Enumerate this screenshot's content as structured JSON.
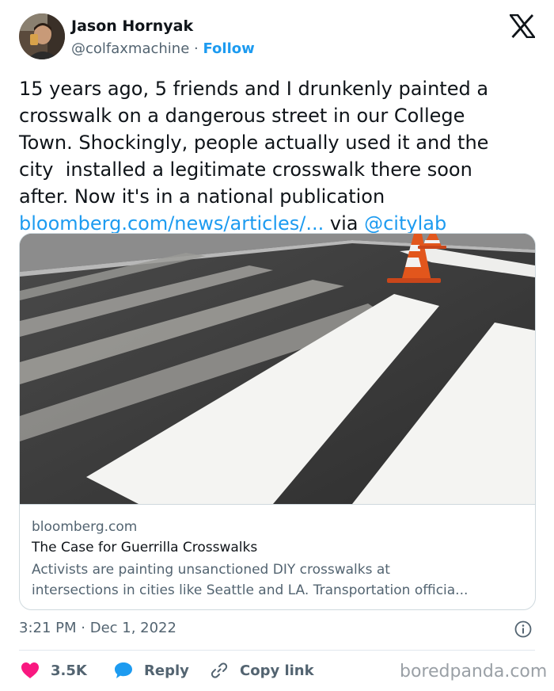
{
  "author": {
    "name": "Jason Hornyak",
    "handle": "@colfaxmachine",
    "separator": " · ",
    "follow_label": "Follow"
  },
  "brand_icon": "x-logo-icon",
  "tweet": {
    "lines": [
      "15 years ago, 5 friends and I drunkenly painted a",
      "crosswalk on a dangerous street in our College",
      "Town. Shockingly, people actually used it and the",
      "city  installed a legitimate crosswalk there soon",
      "after. Now it's in a national publication"
    ],
    "link_text": "bloomberg.com/news/articles/...",
    "via_text": " via ",
    "mention": "@citylab"
  },
  "card": {
    "image_subject": "crosswalk-photo",
    "domain": "bloomberg.com",
    "title": "The Case for Guerrilla Crosswalks",
    "description": "Activists are painting unsanctioned DIY crosswalks at\nintersections in cities like Seattle and LA. Transportation officia..."
  },
  "meta": {
    "time": "3:21 PM",
    "separator": " · ",
    "date": "Dec 1, 2022",
    "info_icon": "info-icon"
  },
  "actions": {
    "like_count": "3.5K",
    "reply_label": "Reply",
    "copy_label": "Copy link"
  },
  "watermark": "boredpanda.com",
  "colors": {
    "link": "#1d9bf0",
    "like": "#f91880",
    "secondary_text": "#536471",
    "primary_text": "#0f1419"
  }
}
